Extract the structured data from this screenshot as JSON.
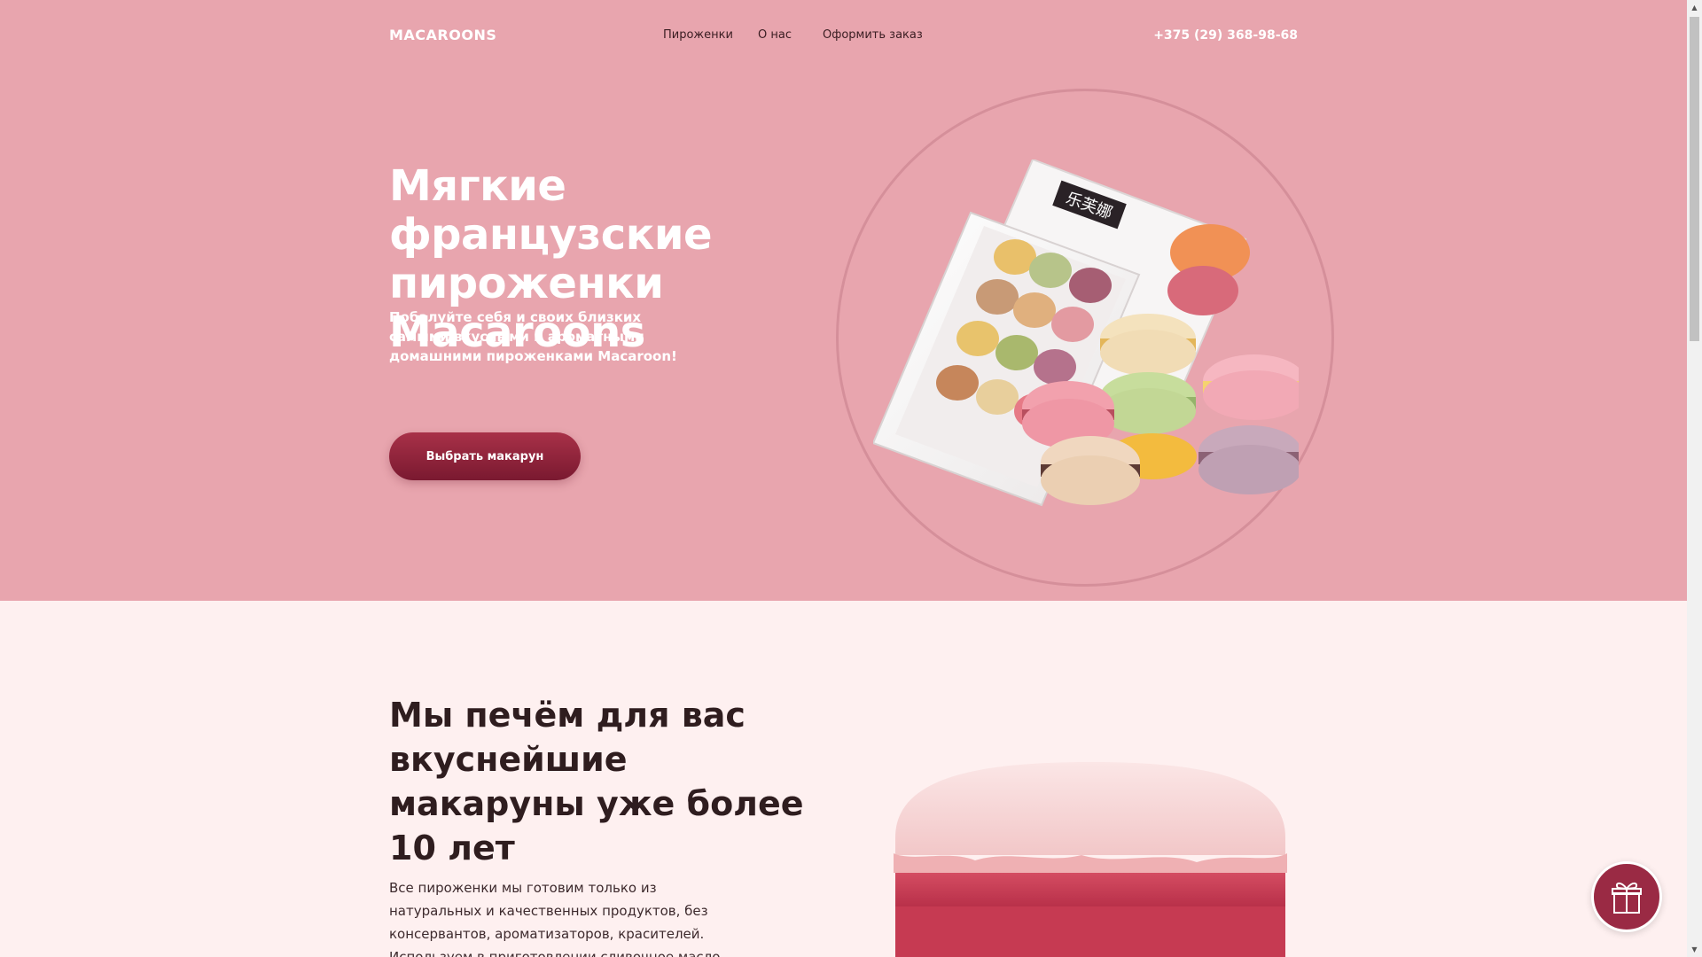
{
  "header": {
    "brand": "MACAROONS",
    "nav": [
      {
        "label": "Пироженки"
      },
      {
        "label": "О нас"
      },
      {
        "label": "Оформить заказ"
      }
    ],
    "phone": "+375 (29) 368-98-68"
  },
  "hero": {
    "title": "Мягкие французские пироженки Macaroons",
    "subtitle": "Побалуйте себя и своих близких самыми вкусными и ароматными домашними пироженками Macaroon!",
    "cta_label": "Выбрать макарун",
    "box_label": "乐芙娜"
  },
  "about": {
    "title": "Мы печём для вас вкуснейшие макаруны уже более 10 лет",
    "text": "Все пироженки мы готовим только из натуральных и качественных продуктов, без консервантов, ароматизаторов, красителей. Используем в приготовлении сливочное масло"
  },
  "colors": {
    "hero_bg": "#e8a5ae",
    "page_bg": "#fef0f0",
    "accent": "#8e2238",
    "gift_bg": "#9a2a44"
  },
  "icons": {
    "gift": "gift-icon",
    "scroll_up": "arrow-up-icon",
    "scroll_down": "arrow-down-icon"
  }
}
